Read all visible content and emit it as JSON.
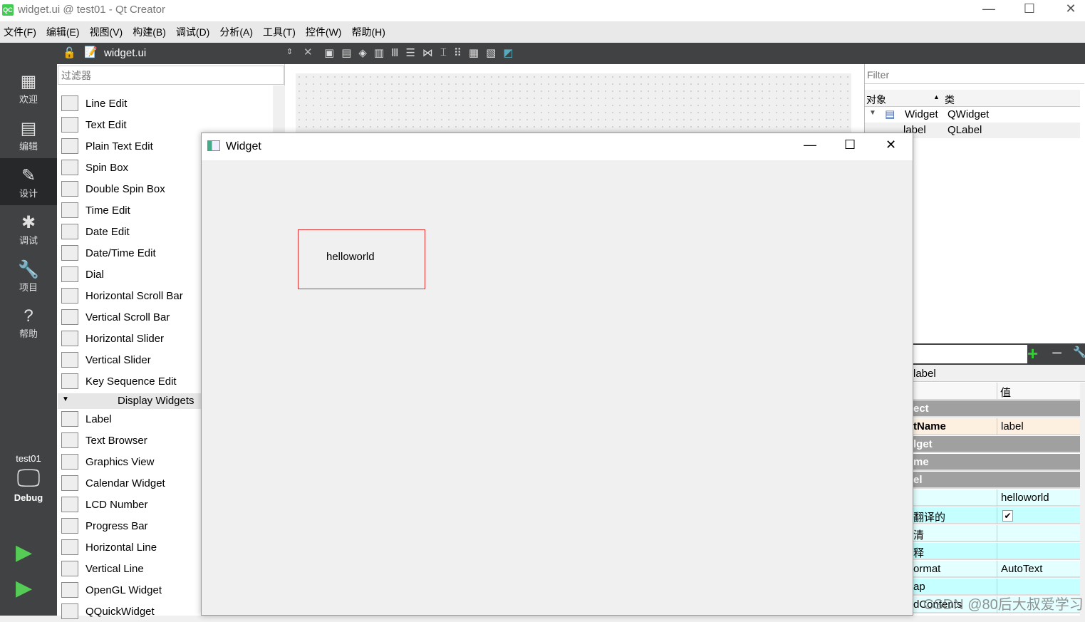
{
  "window": {
    "title": "widget.ui @ test01 - Qt Creator",
    "logo": "QC"
  },
  "menu": [
    "文件(F)",
    "编辑(E)",
    "视图(V)",
    "构建(B)",
    "调试(D)",
    "分析(A)",
    "工具(T)",
    "控件(W)",
    "帮助(H)"
  ],
  "toolbar": {
    "file": "widget.ui"
  },
  "modes": [
    {
      "label": "欢迎",
      "icon": "grid-icon"
    },
    {
      "label": "编辑",
      "icon": "document-icon"
    },
    {
      "label": "设计",
      "icon": "pen-icon"
    },
    {
      "label": "调试",
      "icon": "bug-icon"
    },
    {
      "label": "项目",
      "icon": "wrench-icon"
    },
    {
      "label": "帮助",
      "icon": "help-icon"
    }
  ],
  "kit": {
    "project": "test01",
    "config": "Debug"
  },
  "widget_box": {
    "filter_placeholder": "过滤器",
    "input_items": [
      "Line Edit",
      "Text Edit",
      "Plain Text Edit",
      "Spin Box",
      "Double Spin Box",
      "Time Edit",
      "Date Edit",
      "Date/Time Edit",
      "Dial",
      "Horizontal Scroll Bar",
      "Vertical Scroll Bar",
      "Horizontal Slider",
      "Vertical Slider",
      "Key Sequence Edit"
    ],
    "category": "Display Widgets",
    "display_items": [
      "Label",
      "Text Browser",
      "Graphics View",
      "Calendar Widget",
      "LCD Number",
      "Progress Bar",
      "Horizontal Line",
      "Vertical Line",
      "OpenGL Widget",
      "QQuickWidget"
    ]
  },
  "form": {
    "title": "Widget",
    "label_text": "helloworld"
  },
  "object_inspector": {
    "filter_placeholder": "Filter",
    "col_object": "对象",
    "col_class": "类",
    "rows": [
      {
        "object": "Widget",
        "class": "QWidget"
      },
      {
        "object": "label",
        "class": "QLabel"
      }
    ]
  },
  "property_editor": {
    "object": "label",
    "col_value": "值",
    "rows": [
      {
        "key": "ect",
        "value": "",
        "type": "group"
      },
      {
        "key": "tName",
        "value": "label",
        "type": "name"
      },
      {
        "key": "lget",
        "value": "",
        "type": "group"
      },
      {
        "key": "me",
        "value": "",
        "type": "group"
      },
      {
        "key": "el",
        "value": "",
        "type": "group"
      },
      {
        "key": "",
        "value": "helloworld",
        "type": "a"
      },
      {
        "key": "翻译的",
        "value": "✔",
        "type": "b"
      },
      {
        "key": "清",
        "value": "",
        "type": "a"
      },
      {
        "key": "释",
        "value": "",
        "type": "b"
      },
      {
        "key": "ormat",
        "value": "AutoText",
        "type": "a"
      },
      {
        "key": "ap",
        "value": "",
        "type": "b"
      },
      {
        "key": "dContents",
        "value": "",
        "type": "a"
      }
    ]
  },
  "watermark": "CSDN @80后大叔爱学习"
}
